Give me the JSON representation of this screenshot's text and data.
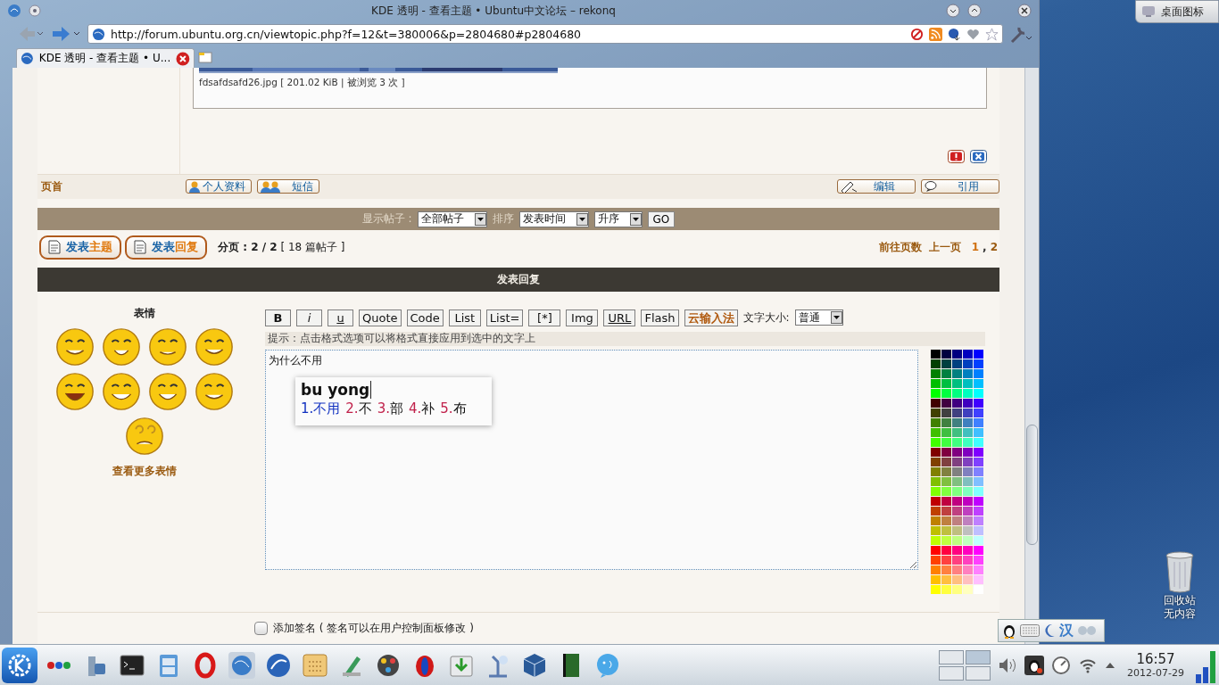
{
  "window": {
    "title": "KDE 透明 - 查看主题 • Ubuntu中文论坛 – rekonq"
  },
  "toolbar": {
    "url": "http://forum.ubuntu.org.cn/viewtopic.php?f=12&t=380006&p=2804680#p2804680"
  },
  "tabs": [
    {
      "label": "KDE 透明 - 查看主题 • U...",
      "selected": true
    }
  ],
  "attachment": {
    "caption": "fdsafdsafd26.jpg [ 201.02 KiB | 被浏览 3 次 ]"
  },
  "post_actions": {
    "top_link": "页首",
    "left_buttons": [
      "个人资料",
      "短信"
    ],
    "right_buttons": [
      "编辑",
      "引用"
    ]
  },
  "sort_bar": {
    "label": "显示帖子 :",
    "filter": "全部帖子",
    "sort_label": "排序",
    "sort_by": "发表时间",
    "order": "升序",
    "go": "GO"
  },
  "pagination_bar": {
    "buttons": [
      {
        "text": "发表",
        "accent": "主题"
      },
      {
        "text": "发表",
        "accent": "回复"
      }
    ],
    "summary": "**分页 : 2 / 2** [ 18 篇帖子 ]",
    "goto": "前往页数",
    "prev": "上一页",
    "separator": ",",
    "pages": [
      {
        "label": "1",
        "selected": true
      },
      {
        "label": "2",
        "selected": false
      }
    ]
  },
  "reply_header": "发表回复",
  "smilies": {
    "title": "表情",
    "more_link": "查看更多表情"
  },
  "format_buttons": [
    {
      "label": "B",
      "kind": "bold"
    },
    {
      "label": "i",
      "kind": "italic"
    },
    {
      "label": "u",
      "kind": "underline"
    },
    {
      "label": "Quote",
      "kind": "plain"
    },
    {
      "label": "Code",
      "kind": "plain"
    },
    {
      "label": "List",
      "kind": "plain"
    },
    {
      "label": "List=",
      "kind": "plain"
    },
    {
      "label": "[*]",
      "kind": "plain"
    },
    {
      "label": "Img",
      "kind": "plain"
    },
    {
      "label": "URL",
      "kind": "underline"
    },
    {
      "label": "Flash",
      "kind": "plain"
    },
    {
      "label": "云输入法",
      "kind": "accent"
    }
  ],
  "font_size": {
    "label": "文字大小:",
    "value": "普通"
  },
  "hint": "提示：点击格式选项可以将格式直接应用到选中的文字上",
  "message": {
    "value": "为什么不用"
  },
  "ime_popup": {
    "input": "bu yong",
    "candidates": [
      {
        "index": "1.",
        "text": "不用",
        "selected": true
      },
      {
        "index": "2.",
        "text": "不",
        "selected": false
      },
      {
        "index": "3.",
        "text": "部",
        "selected": false
      },
      {
        "index": "4.",
        "text": "补",
        "selected": false
      },
      {
        "index": "5.",
        "text": "布",
        "selected": false
      }
    ]
  },
  "signature": {
    "label": "添加签名 ( 签名可以在用户控制面板修改 )",
    "checked": false
  },
  "desktop": {
    "show_desktop_button": "桌面图标",
    "trash_label": "回收站",
    "trash_status": "无内容"
  },
  "ime_status": {
    "mode": "汉"
  },
  "taskbar": {
    "time": "16:57",
    "date": "2012-07-29"
  }
}
